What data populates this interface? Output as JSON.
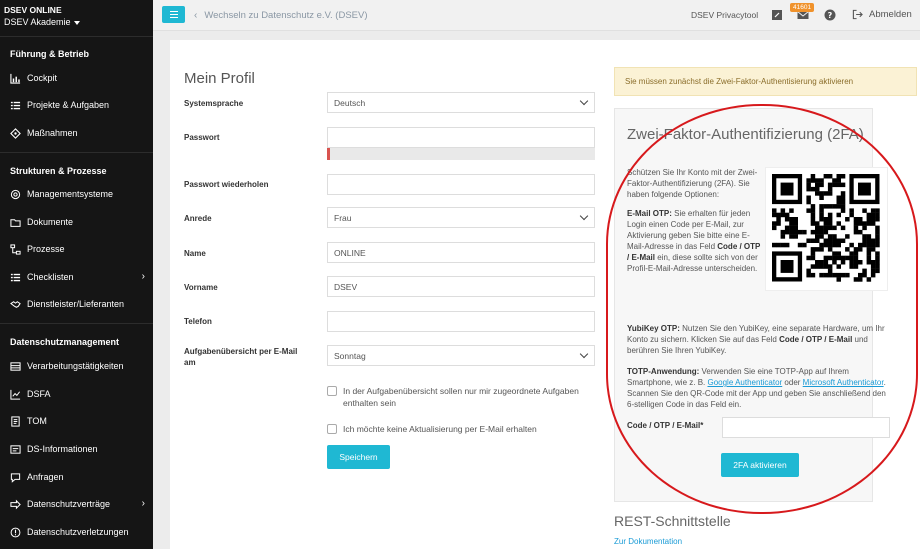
{
  "sidebar": {
    "org_title": "DSEV ONLINE",
    "org_sub": "DSEV Akademie",
    "sections": {
      "fuehrung": "Führung & Betrieb",
      "strukturen": "Strukturen & Prozesse",
      "datenschutz": "Datenschutzmanagement"
    },
    "items": {
      "cockpit": "Cockpit",
      "projekte": "Projekte & Aufgaben",
      "massnahmen": "Maßnahmen",
      "managementsysteme": "Managementsysteme",
      "dokumente": "Dokumente",
      "prozesse": "Prozesse",
      "checklisten": "Checklisten",
      "dienstleister": "Dienstleister/Lieferanten",
      "verarbeitung": "Verarbeitungstätigkeiten",
      "dsfa": "DSFA",
      "tom": "TOM",
      "dsinfo": "DS-Informationen",
      "anfragen": "Anfragen",
      "vertraege": "Datenschutzverträge",
      "verletzungen": "Datenschutzverletzungen"
    }
  },
  "topbar": {
    "switch_link": "Wechseln zu Datenschutz e.V. (DSEV)",
    "privacy_tool": "DSEV Privacytool",
    "mail_badge": "41601",
    "logout": "Abmelden"
  },
  "profile": {
    "title": "Mein Profil",
    "labels": {
      "language": "Systemsprache",
      "password": "Passwort",
      "password_repeat": "Passwort wiederholen",
      "salutation": "Anrede",
      "name": "Name",
      "firstname": "Vorname",
      "phone": "Telefon",
      "task_overview": "Aufgabenübersicht per E-Mail am"
    },
    "values": {
      "language": "Deutsch",
      "password": "",
      "password_repeat": "",
      "salutation": "Frau",
      "name": "ONLINE",
      "firstname": "DSEV",
      "phone": "",
      "task_overview": "Sonntag"
    },
    "password_strength": 0.01,
    "check_assigned": "In der Aufgabenübersicht sollen nur mir zugeordnete Aufgaben enthalten sein",
    "check_no_updates": "Ich möchte keine Aktualisierung per E-Mail erhalten",
    "save": "Speichern"
  },
  "alert": "Sie müssen zunächst die Zwei-Faktor-Authentisierung aktivieren",
  "tfa": {
    "title": "Zwei-Faktor-Authentifizierung (2FA)",
    "intro": "Schützen Sie Ihr Konto mit der Zwei-Faktor-Authentifizierung (2FA). Sie haben folgende Optionen:",
    "email_otp_label": "E-Mail OTP:",
    "email_otp_text1": " Sie erhalten für jeden Login einen Code per E-Mail, zur Aktivierung geben Sie bitte eine E-Mail-Adresse in das Feld ",
    "email_otp_field": "Code / OTP / E-Mail",
    "email_otp_text2": " ein, diese sollte sich von der Profil-E-Mail-Adresse unterscheiden.",
    "yubikey_label": "YubiKey OTP:",
    "yubikey_text1": " Nutzen Sie den YubiKey, eine separate Hardware, um Ihr Konto zu sichern. Klicken Sie auf das Feld ",
    "yubikey_field": "Code / OTP / E-Mail",
    "yubikey_text2": " und berühren Sie Ihren YubiKey.",
    "totp_label": "TOTP-Anwendung:",
    "totp_text1": " Verwenden Sie eine TOTP-App auf Ihrem Smartphone, wie z. B. ",
    "totp_link1": "Google Authenticator",
    "totp_text2": " oder ",
    "totp_link2": "Microsoft Authenticator",
    "totp_text3": ". Scannen Sie den QR-Code mit der App und geben Sie anschließend den 6-stelligen Code in das Feld ein.",
    "code_label": "Code / OTP / E-Mail*",
    "activate": "2FA aktivieren"
  },
  "rest": {
    "title": "REST-Schnittstelle",
    "doc_link": "Zur Dokumentation"
  },
  "colors": {
    "accent": "#1fb8d3",
    "sidebar_bg": "#151515",
    "highlight": "#d7191c",
    "alert_bg": "#fbf2d5"
  }
}
